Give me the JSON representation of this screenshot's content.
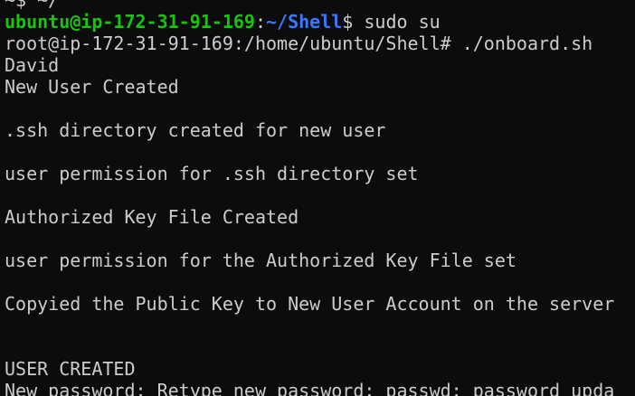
{
  "colors": {
    "background": "#0c0c0c",
    "foreground": "#cccccc",
    "prompt_user": "#16c60c",
    "prompt_path": "#3b78ff"
  },
  "terminal": {
    "top_partial_text": "~$ ~/",
    "prompt": {
      "user_host": "ubuntu@ip-172-31-91-169",
      "separator": ":",
      "path": "~/Shell",
      "symbol": "$",
      "command": " sudo su"
    },
    "lines": [
      "root@ip-172-31-91-169:/home/ubuntu/Shell# ./onboard.sh",
      "David",
      "New User Created",
      "",
      ".ssh directory created for new user",
      "",
      "user permission for .ssh directory set",
      "",
      "Authorized Key File Created",
      "",
      "user permission for the Authorized Key File set",
      "",
      "Copyied the Public Key to New User Account on the server",
      "",
      "",
      "USER CREATED",
      "New password: Retype new password: passwd: password upda"
    ]
  }
}
